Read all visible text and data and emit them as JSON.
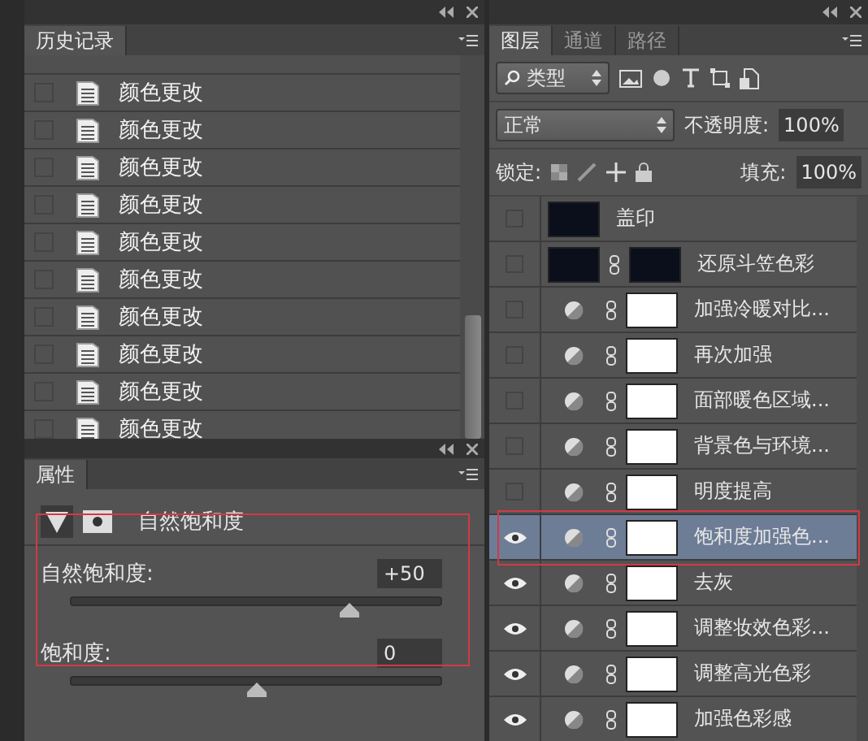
{
  "history_panel": {
    "tab": "历史记录",
    "items": [
      {
        "label": "颜色更改"
      },
      {
        "label": "颜色更改"
      },
      {
        "label": "颜色更改"
      },
      {
        "label": "颜色更改"
      },
      {
        "label": "颜色更改"
      },
      {
        "label": "颜色更改"
      },
      {
        "label": "颜色更改"
      },
      {
        "label": "颜色更改"
      },
      {
        "label": "颜色更改"
      },
      {
        "label": "颜色更改"
      }
    ]
  },
  "properties_panel": {
    "tab": "属性",
    "adjustment_title": "自然饱和度",
    "sliders": [
      {
        "label": "自然饱和度:",
        "value": "+50",
        "level": 0.75
      },
      {
        "label": "饱和度:",
        "value": "0",
        "level": 0.5
      }
    ]
  },
  "layers_panel": {
    "tabs": [
      {
        "label": "图层",
        "selected": true
      },
      {
        "label": "通道",
        "selected": false
      },
      {
        "label": "路径",
        "selected": false
      }
    ],
    "filter": "类型",
    "blend_mode": "正常",
    "opacity_label": "不透明度:",
    "opacity": "100%",
    "lock_label": "锁定:",
    "fill_label": "填充:",
    "fill": "100%",
    "layers": [
      {
        "name": "盖印",
        "kind": "pixel",
        "visible": false,
        "selected": false
      },
      {
        "name": "还原斗笠色彩",
        "kind": "masked",
        "visible": false,
        "selected": false
      },
      {
        "name": "加强冷暖对比...",
        "kind": "adjustment",
        "visible": false,
        "selected": false
      },
      {
        "name": "再次加强",
        "kind": "adjustment",
        "visible": false,
        "selected": false
      },
      {
        "name": "面部暖色区域...",
        "kind": "adjustment",
        "visible": false,
        "selected": false
      },
      {
        "name": "背景色与环境...",
        "kind": "adjustment",
        "visible": false,
        "selected": false
      },
      {
        "name": "明度提高",
        "kind": "adjustment",
        "visible": false,
        "selected": false
      },
      {
        "name": "饱和度加强色...",
        "kind": "adjustment",
        "visible": true,
        "selected": true
      },
      {
        "name": "去灰",
        "kind": "adjustment",
        "visible": true,
        "selected": false
      },
      {
        "name": "调整妆效色彩...",
        "kind": "adjustment",
        "visible": true,
        "selected": false
      },
      {
        "name": "调整高光色彩",
        "kind": "adjustment",
        "visible": true,
        "selected": false
      },
      {
        "name": "加强色彩感",
        "kind": "adjustment",
        "visible": true,
        "selected": false
      }
    ]
  }
}
